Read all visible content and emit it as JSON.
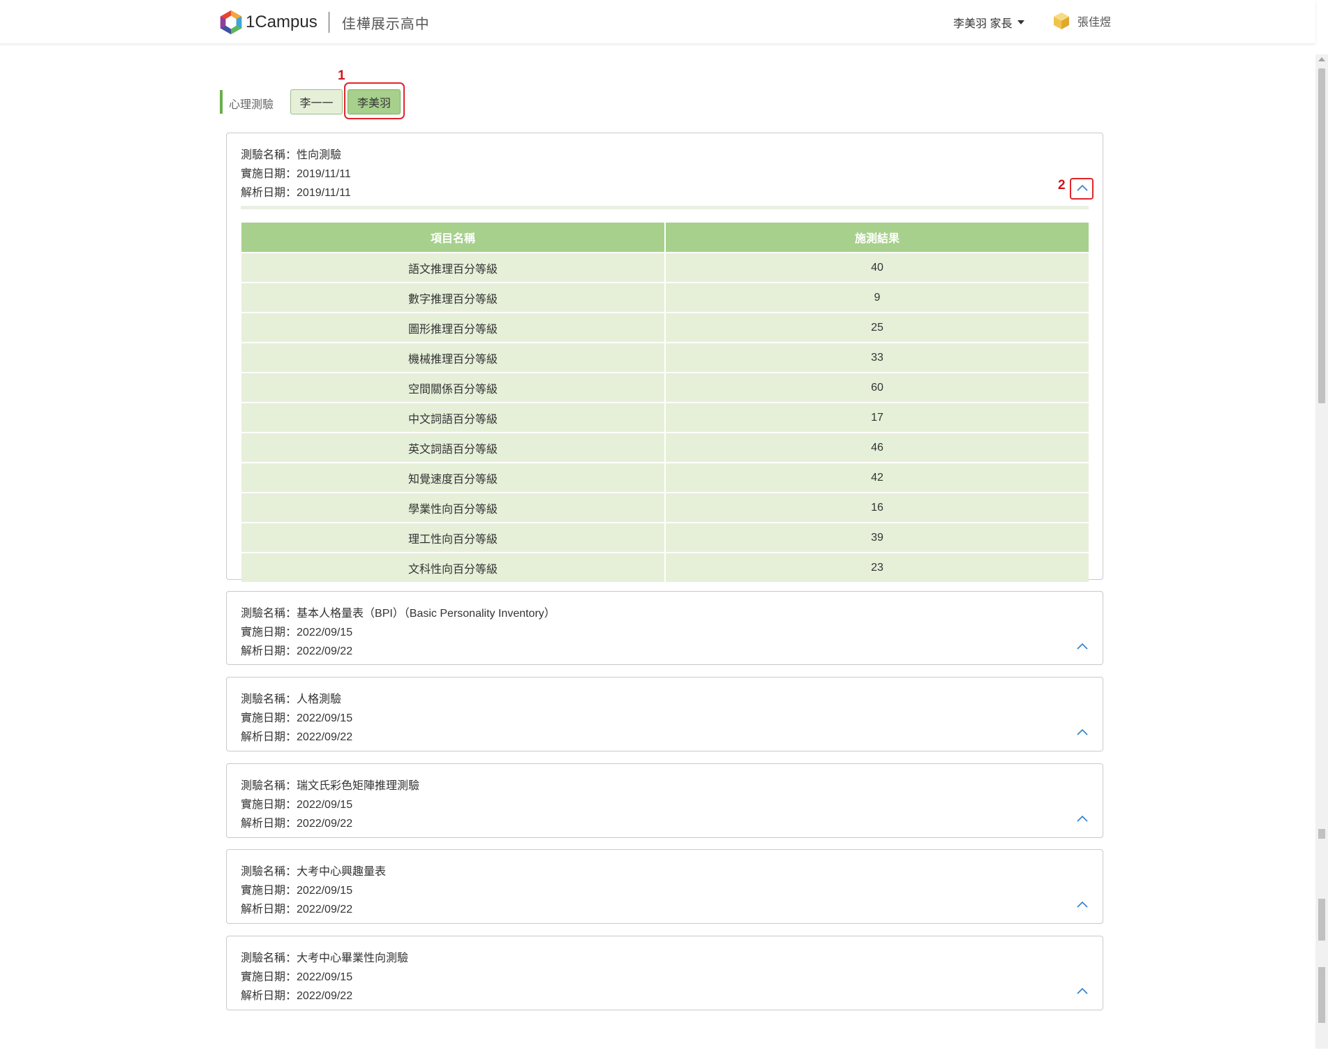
{
  "header": {
    "brand": "1Campus",
    "school": "佳樺展示高中",
    "user_menu": "李美羽 家長",
    "account_name": "張佳煜"
  },
  "tabs": {
    "section_label": "心理測驗",
    "items": [
      {
        "label": "李一一",
        "selected": false
      },
      {
        "label": "李美羽",
        "selected": true
      }
    ]
  },
  "annotations": {
    "one": "1",
    "two": "2"
  },
  "labels": {
    "test_name": "測驗名稱：",
    "implement_date": "實施日期：",
    "analysis_date": "解析日期："
  },
  "tests": [
    {
      "name": "性向測驗",
      "implement_date": "2019/11/11",
      "analysis_date": "2019/11/11",
      "expanded": true,
      "table": {
        "headers": [
          "項目名稱",
          "施測結果"
        ],
        "rows": [
          {
            "item": "語文推理百分等級",
            "result": "40"
          },
          {
            "item": "數字推理百分等級",
            "result": "9"
          },
          {
            "item": "圖形推理百分等級",
            "result": "25"
          },
          {
            "item": "機械推理百分等級",
            "result": "33"
          },
          {
            "item": "空間關係百分等級",
            "result": "60"
          },
          {
            "item": "中文詞語百分等級",
            "result": "17"
          },
          {
            "item": "英文詞語百分等級",
            "result": "46"
          },
          {
            "item": "知覺速度百分等級",
            "result": "42"
          },
          {
            "item": "學業性向百分等級",
            "result": "16"
          },
          {
            "item": "理工性向百分等級",
            "result": "39"
          },
          {
            "item": "文科性向百分等級",
            "result": "23"
          }
        ]
      }
    },
    {
      "name": "基本人格量表（BPI）（Basic Personality Inventory）",
      "implement_date": "2022/09/15",
      "analysis_date": "2022/09/22",
      "expanded": false
    },
    {
      "name": "人格測驗",
      "implement_date": "2022/09/15",
      "analysis_date": "2022/09/22",
      "expanded": false
    },
    {
      "name": "瑞文氏彩色矩陣推理測驗",
      "implement_date": "2022/09/15",
      "analysis_date": "2022/09/22",
      "expanded": false
    },
    {
      "name": "大考中心興趣量表",
      "implement_date": "2022/09/15",
      "analysis_date": "2022/09/22",
      "expanded": false
    },
    {
      "name": "大考中心畢業性向測驗",
      "implement_date": "2022/09/15",
      "analysis_date": "2022/09/22",
      "expanded": false
    }
  ],
  "colors": {
    "accent_green": "#a7d08c",
    "row_green": "#e6f0d9",
    "annotation_red": "#e0262a",
    "chevron_blue": "#2f7fc9"
  }
}
